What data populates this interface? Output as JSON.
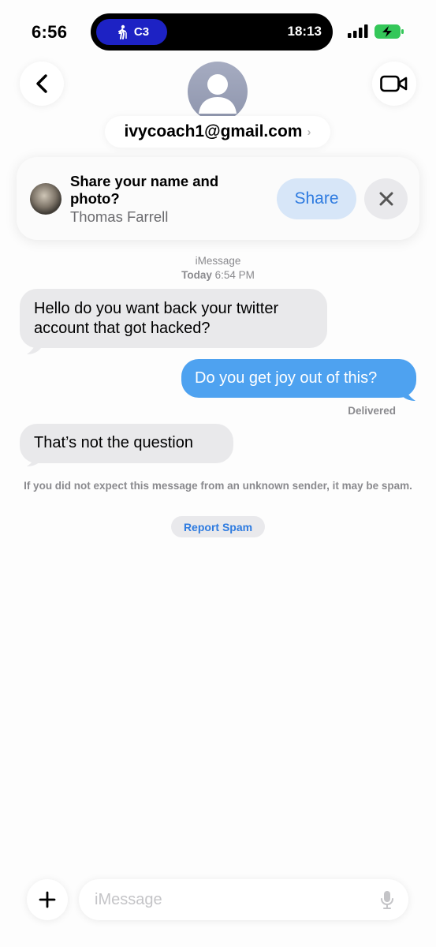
{
  "status_bar": {
    "time": "6:56",
    "island_label": "C3",
    "island_time": "18:13",
    "icons": [
      "walking-person-icon",
      "signal-icon",
      "battery-charging-icon"
    ]
  },
  "header": {
    "contact": "ivycoach1@gmail.com",
    "chevron": "›",
    "icons": [
      "back-chevron-icon",
      "contact-avatar-icon",
      "video-call-icon"
    ]
  },
  "share_card": {
    "title": "Share your name and photo?",
    "name": "Thomas Farrell",
    "share_label": "Share",
    "icons": [
      "close-icon"
    ]
  },
  "thread": {
    "service": "iMessage",
    "day": "Today",
    "time": "6:54 PM",
    "messages": [
      {
        "direction": "incoming",
        "text": "Hello do you want back your twitter account that got hacked?"
      },
      {
        "direction": "outgoing",
        "text": "Do you get joy out of this?"
      },
      {
        "direction": "incoming",
        "text": "That’s not the question"
      }
    ],
    "delivered": "Delivered",
    "spam_notice": "If you did not expect this message from an unknown sender, it may be spam.",
    "report_spam": "Report Spam"
  },
  "composer": {
    "placeholder": "iMessage",
    "value": "",
    "icons": [
      "plus-icon",
      "microphone-icon"
    ]
  },
  "colors": {
    "accent": "#2e7be0",
    "outgoing_bubble": "#4ea2f0",
    "incoming_bubble": "#e9e9eb",
    "island_pill": "#1d22c4",
    "battery_green": "#34c759"
  }
}
